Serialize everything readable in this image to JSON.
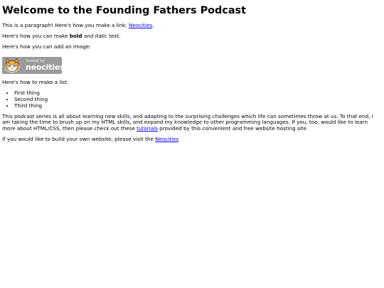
{
  "page": {
    "heading": "Welcome to the Founding Fathers Podcast"
  },
  "para1": {
    "prefix": "This is a paragraph! Here's how you make a link: ",
    "link_text": "Neocities",
    "suffix": "."
  },
  "para2": {
    "prefix": "Here's how you can make ",
    "bold_text": "bold",
    "middle": " and ",
    "italic_text": "italic",
    "suffix": " text."
  },
  "para3": {
    "text": "Here's how you can add an image:"
  },
  "badge": {
    "hosted_text": "hosted by",
    "brand_text": "neocities",
    "icon": "neocities-cat-logo"
  },
  "list_intro": {
    "text": "Here's how to make a list:"
  },
  "list_items": [
    "First thing",
    "Second thing",
    "Third thing"
  ],
  "description": {
    "text_before": "This podcast series is all about learning new skills, and adapting to the surprising challenges which life can sometimes throw at us. To that end, I am taking the time to brush up on my HTML skills, and expand my knowledge to other programming languages. If you, too, would like to learn more about HTML/CSS, then please check out these ",
    "link_text": "tutorials",
    "text_after": " provided by this convenient and free website hosting site."
  },
  "closing": {
    "prefix": "If you would like to build your own website, please visit the ",
    "link_text": "Neocities"
  },
  "colors": {
    "link": "#0000ee",
    "badge_bg": "#9b9b9b",
    "text": "#000000"
  }
}
